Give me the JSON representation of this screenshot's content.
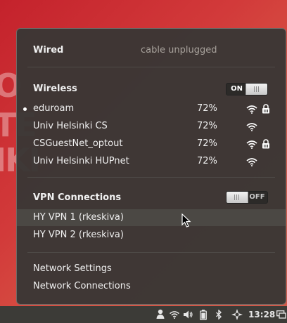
{
  "wired": {
    "title": "Wired",
    "status": "cable unplugged"
  },
  "wireless": {
    "title": "Wireless",
    "toggle_label": "ON",
    "networks": [
      {
        "name": "eduroam",
        "signal": "72%",
        "connected": true,
        "secured": true
      },
      {
        "name": "Univ Helsinki CS",
        "signal": "72%",
        "connected": false,
        "secured": false
      },
      {
        "name": "CSGuestNet_optout",
        "signal": "72%",
        "connected": false,
        "secured": true
      },
      {
        "name": "Univ Helsinki HUPnet",
        "signal": "72%",
        "connected": false,
        "secured": false
      }
    ]
  },
  "vpn": {
    "title": "VPN Connections",
    "toggle_label": "OFF",
    "connections": [
      "HY VPN 1 (rkeskiva)",
      "HY VPN 2 (rkeskiva)"
    ]
  },
  "footer": {
    "settings": "Network Settings",
    "connections": "Network Connections"
  },
  "panel": {
    "time": "13:28"
  },
  "colors": {
    "menu_bg": "#3a3735",
    "panel_bg": "#3c3b37",
    "wallpaper": "#c4222c"
  }
}
